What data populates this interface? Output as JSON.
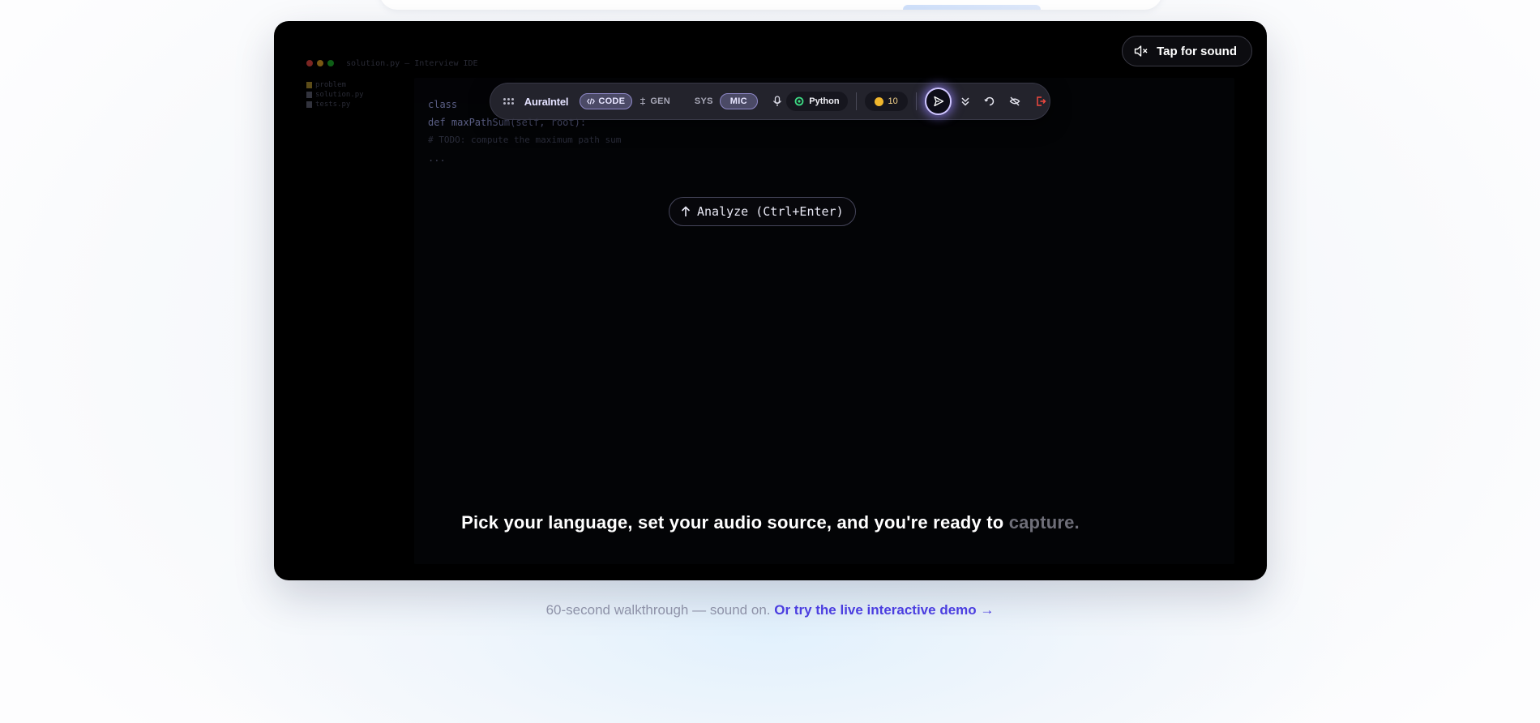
{
  "ide": {
    "title": "solution.py — Interview IDE",
    "files": [
      {
        "name": "problem",
        "type": "folder"
      },
      {
        "name": "solution.py",
        "type": "file"
      },
      {
        "name": "tests.py",
        "type": "file"
      }
    ],
    "code_lines": [
      "class",
      "def maxPathSum(self, root):",
      "# TODO: compute the maximum path sum",
      "",
      "..."
    ]
  },
  "toolbar": {
    "brand": "AuraIntel",
    "mode_code": "CODE",
    "mode_gen": "GEN",
    "source_sys": "SYS",
    "source_mic": "MIC",
    "language": "Python",
    "credits": "10"
  },
  "sound_button": {
    "label": "Tap for sound"
  },
  "analyze_button": {
    "label": "Analyze (Ctrl+Enter)"
  },
  "caption": {
    "main": "Pick your language, set your audio source, and you're ready to",
    "dim": "capture."
  },
  "footer": {
    "text": "60-second walkthrough — sound on.",
    "link": "Or try the live interactive demo →"
  },
  "colors": {
    "accent": "#4b3ee0",
    "play_glow": "#cfc6ff",
    "coin": "#f1b72d",
    "exit_icon": "#f0483e",
    "python_icon": "#3ddc84"
  }
}
